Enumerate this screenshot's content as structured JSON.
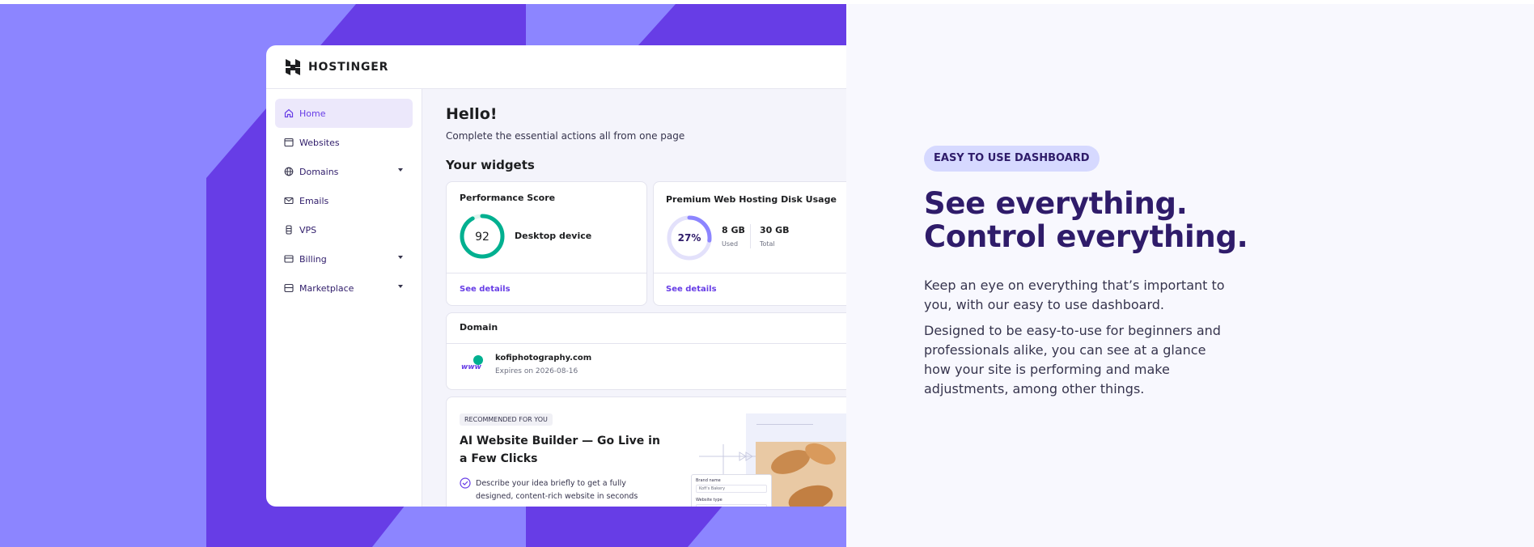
{
  "brand": {
    "name": "HOSTINGER"
  },
  "sidebar": {
    "items": [
      {
        "label": "Home",
        "icon": "home-icon",
        "active": true,
        "expandable": false
      },
      {
        "label": "Websites",
        "icon": "browser-icon",
        "active": false,
        "expandable": false
      },
      {
        "label": "Domains",
        "icon": "globe-icon",
        "active": false,
        "expandable": true
      },
      {
        "label": "Emails",
        "icon": "mail-icon",
        "active": false,
        "expandable": false
      },
      {
        "label": "VPS",
        "icon": "server-icon",
        "active": false,
        "expandable": false
      },
      {
        "label": "Billing",
        "icon": "card-icon",
        "active": false,
        "expandable": true
      },
      {
        "label": "Marketplace",
        "icon": "store-icon",
        "active": false,
        "expandable": true
      }
    ]
  },
  "main": {
    "greeting": "Hello!",
    "subtitle": "Complete the essential actions all from one page",
    "widgets_title": "Your widgets",
    "performance": {
      "title": "Performance Score",
      "score": "92",
      "score_fraction": 0.92,
      "device": "Desktop device",
      "link": "See details"
    },
    "disk": {
      "title": "Premium Web Hosting Disk Usage",
      "percent": "27%",
      "fraction": 0.27,
      "used_value": "8 GB",
      "used_label": "Used",
      "total_value": "30 GB",
      "total_label": "Total",
      "link": "See details"
    },
    "domain": {
      "title": "Domain",
      "icon_text": "www",
      "name": "kofiphotography.com",
      "expires": "Expires on 2026-08-16"
    },
    "recommendation": {
      "tag": "RECOMMENDED FOR YOU",
      "title": "AI Website Builder — Go Live in a Few Clicks",
      "bullet": "Describe your idea briefly to get a fully designed, content-rich website in seconds",
      "form_label_1": "Brand name",
      "form_value_1": "Kofi's Bakery",
      "form_label_2": "Website type"
    }
  },
  "right": {
    "badge": "EASY TO USE DASHBOARD",
    "headline_line1": "See everything.",
    "headline_line2": "Control everything.",
    "paragraph1": "Keep an eye on everything that’s important to you, with our easy to use dashboard.",
    "paragraph2": "Designed to be easy-to-use for beginners and professionals alike, you can see at a glance how your site is performing and make adjustments, among other things."
  },
  "colors": {
    "hero_light": "#8c85ff",
    "hero_dark": "#673de6",
    "accent": "#673de6",
    "success": "#00b090",
    "headline": "#2f1c6a"
  }
}
